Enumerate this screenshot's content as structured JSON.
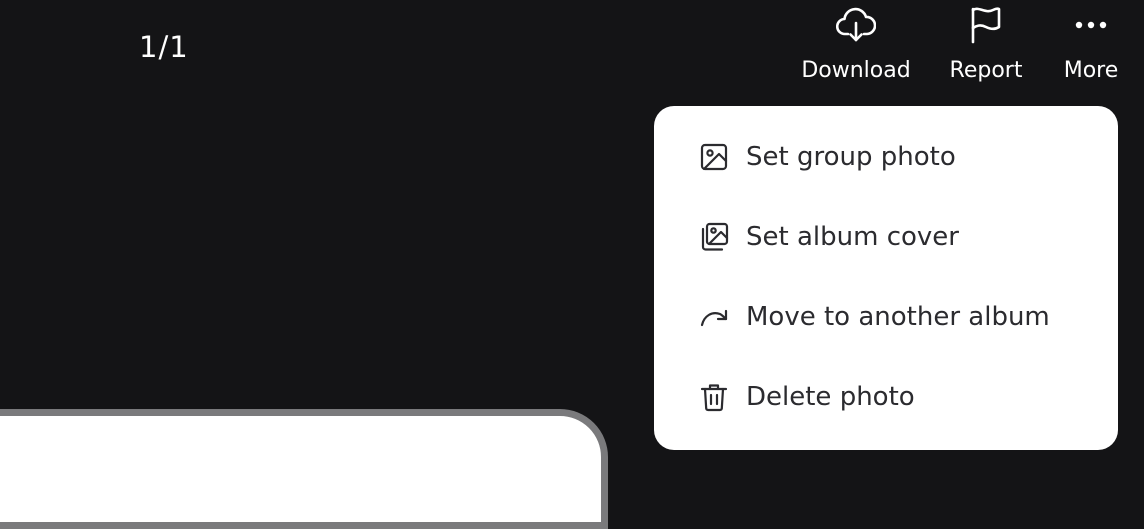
{
  "viewer": {
    "counter": "1/1"
  },
  "toolbar": {
    "download": {
      "label": "Download",
      "icon": "cloud-download-icon"
    },
    "report": {
      "label": "Report",
      "icon": "flag-icon"
    },
    "more": {
      "label": "More",
      "icon": "more-dots-icon"
    }
  },
  "menu": {
    "items": [
      {
        "label": "Set group photo",
        "icon": "image-icon"
      },
      {
        "label": "Set album cover",
        "icon": "images-stack-icon"
      },
      {
        "label": "Move to another album",
        "icon": "redo-arrow-icon"
      },
      {
        "label": "Delete photo",
        "icon": "trash-icon"
      }
    ]
  },
  "colors": {
    "background": "#141416",
    "menu_background": "#ffffff",
    "menu_text": "#2b2b2f",
    "toolbar_text": "#ffffff"
  }
}
